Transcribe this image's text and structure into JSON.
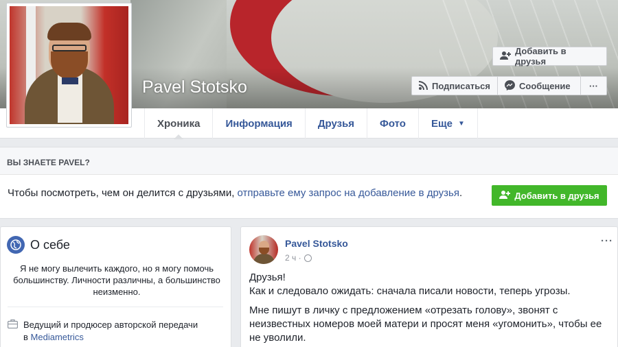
{
  "profile": {
    "name": "Pavel Stotsko"
  },
  "cover_actions": {
    "add_friend": "Добавить в друзья",
    "follow": "Подписаться",
    "message": "Сообщение",
    "more": "···"
  },
  "tabs": [
    {
      "label": "Хроника",
      "active": true
    },
    {
      "label": "Информация",
      "active": false
    },
    {
      "label": "Друзья",
      "active": false
    },
    {
      "label": "Фото",
      "active": false
    },
    {
      "label": "Еще",
      "active": false
    }
  ],
  "know_box": {
    "heading": "ВЫ ЗНАЕТЕ PAVEL?",
    "text": "Чтобы посмотреть, чем он делится с друзьями, ",
    "link": "отправьте ему запрос на добавление в друзья",
    "text_end": ".",
    "button": "Добавить в друзья"
  },
  "about": {
    "title": "О себе",
    "bio": "Я не могу вылечить каждого, но я могу помочь большинству. Личности различны, а большинство неизменно.",
    "job_text": "Ведущий и продюсер авторской передачи",
    "job_prefix": "в ",
    "job_link": "Mediametrics"
  },
  "post": {
    "author": "Pavel Stotsko",
    "time": "2 ч ·",
    "more": "···",
    "line1": "Друзья!",
    "line2": "Как и следовало ожидать: сначала писали новости, теперь угрозы.",
    "paragraph2": "Мне пишут в личку с предложением «отрезать голову», звонят с неизвестных номеров моей матери и просят меня «угомонить», чтобы ее не уволили."
  },
  "icons": {
    "add_friend": "add-friend-icon",
    "follow": "rss-icon",
    "message": "messenger-icon",
    "about": "globe-icon",
    "job": "briefcase-icon",
    "privacy": "globe-icon"
  },
  "colors": {
    "link": "#365899",
    "green_button": "#42b72a",
    "background": "#e9ebee"
  }
}
